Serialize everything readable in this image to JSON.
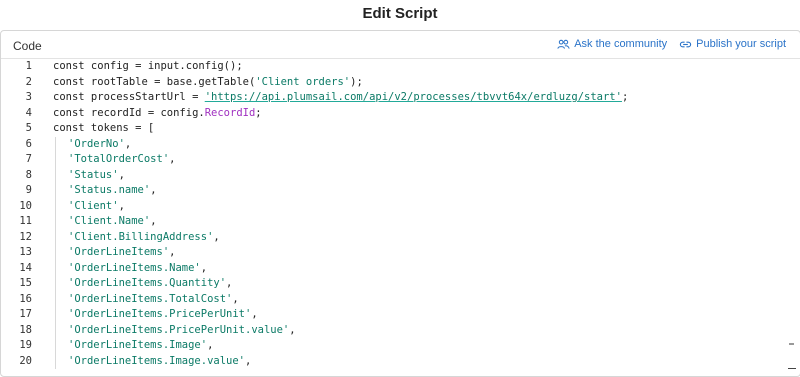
{
  "window": {
    "title": "Edit Script"
  },
  "header": {
    "code_label": "Code",
    "ask_community": "Ask the community",
    "publish_script": "Publish your script"
  },
  "editor": {
    "line_numbers": [
      "1",
      "2",
      "3",
      "4",
      "5",
      "6",
      "7",
      "8",
      "9",
      "10",
      "11",
      "12",
      "13",
      "14",
      "15",
      "16",
      "17",
      "18",
      "19",
      "20"
    ],
    "lines": [
      {
        "indent": false,
        "parts": [
          {
            "t": "const config = input.config();",
            "c": "kw"
          }
        ]
      },
      {
        "indent": false,
        "parts": [
          {
            "t": "const rootTable = base.getTable(",
            "c": "kw"
          },
          {
            "t": "'Client orders'",
            "c": "str"
          },
          {
            "t": ");",
            "c": "kw"
          }
        ]
      },
      {
        "indent": false,
        "parts": [
          {
            "t": "const processStartUrl = ",
            "c": "kw"
          },
          {
            "t": "'https://api.plumsail.com/api/v2/processes/tbvvt64x/erdluzg/start'",
            "c": "url"
          },
          {
            "t": ";",
            "c": "kw"
          }
        ]
      },
      {
        "indent": false,
        "parts": [
          {
            "t": "const recordId = config.",
            "c": "kw"
          },
          {
            "t": "RecordId",
            "c": "prop"
          },
          {
            "t": ";",
            "c": "kw"
          }
        ]
      },
      {
        "indent": false,
        "parts": [
          {
            "t": "const tokens = [",
            "c": "kw"
          }
        ]
      },
      {
        "indent": true,
        "parts": [
          {
            "t": "'OrderNo'",
            "c": "str"
          },
          {
            "t": ",",
            "c": "kw"
          }
        ]
      },
      {
        "indent": true,
        "parts": [
          {
            "t": "'TotalOrderCost'",
            "c": "str"
          },
          {
            "t": ",",
            "c": "kw"
          }
        ]
      },
      {
        "indent": true,
        "parts": [
          {
            "t": "'Status'",
            "c": "str"
          },
          {
            "t": ",",
            "c": "kw"
          }
        ]
      },
      {
        "indent": true,
        "parts": [
          {
            "t": "'Status.name'",
            "c": "str"
          },
          {
            "t": ",",
            "c": "kw"
          }
        ]
      },
      {
        "indent": true,
        "parts": [
          {
            "t": "'Client'",
            "c": "str"
          },
          {
            "t": ",",
            "c": "kw"
          }
        ]
      },
      {
        "indent": true,
        "parts": [
          {
            "t": "'Client.Name'",
            "c": "str"
          },
          {
            "t": ",",
            "c": "kw"
          }
        ]
      },
      {
        "indent": true,
        "parts": [
          {
            "t": "'Client.BillingAddress'",
            "c": "str"
          },
          {
            "t": ",",
            "c": "kw"
          }
        ]
      },
      {
        "indent": true,
        "parts": [
          {
            "t": "'OrderLineItems'",
            "c": "str"
          },
          {
            "t": ",",
            "c": "kw"
          }
        ]
      },
      {
        "indent": true,
        "parts": [
          {
            "t": "'OrderLineItems.Name'",
            "c": "str"
          },
          {
            "t": ",",
            "c": "kw"
          }
        ]
      },
      {
        "indent": true,
        "parts": [
          {
            "t": "'OrderLineItems.Quantity'",
            "c": "str"
          },
          {
            "t": ",",
            "c": "kw"
          }
        ]
      },
      {
        "indent": true,
        "parts": [
          {
            "t": "'OrderLineItems.TotalCost'",
            "c": "str"
          },
          {
            "t": ",",
            "c": "kw"
          }
        ]
      },
      {
        "indent": true,
        "parts": [
          {
            "t": "'OrderLineItems.PricePerUnit'",
            "c": "str"
          },
          {
            "t": ",",
            "c": "kw"
          }
        ]
      },
      {
        "indent": true,
        "parts": [
          {
            "t": "'OrderLineItems.PricePerUnit.value'",
            "c": "str"
          },
          {
            "t": ",",
            "c": "kw"
          }
        ]
      },
      {
        "indent": true,
        "parts": [
          {
            "t": "'OrderLineItems.Image'",
            "c": "str"
          },
          {
            "t": ",",
            "c": "kw"
          }
        ]
      },
      {
        "indent": true,
        "parts": [
          {
            "t": "'OrderLineItems.Image.value'",
            "c": "str"
          },
          {
            "t": ",",
            "c": "kw"
          }
        ]
      }
    ]
  },
  "icons": {
    "ask_community": "people-icon",
    "publish_script": "link-icon"
  },
  "colors": {
    "accent": "#2a73c8",
    "string": "#0b7a66",
    "property": "#a030c0"
  }
}
